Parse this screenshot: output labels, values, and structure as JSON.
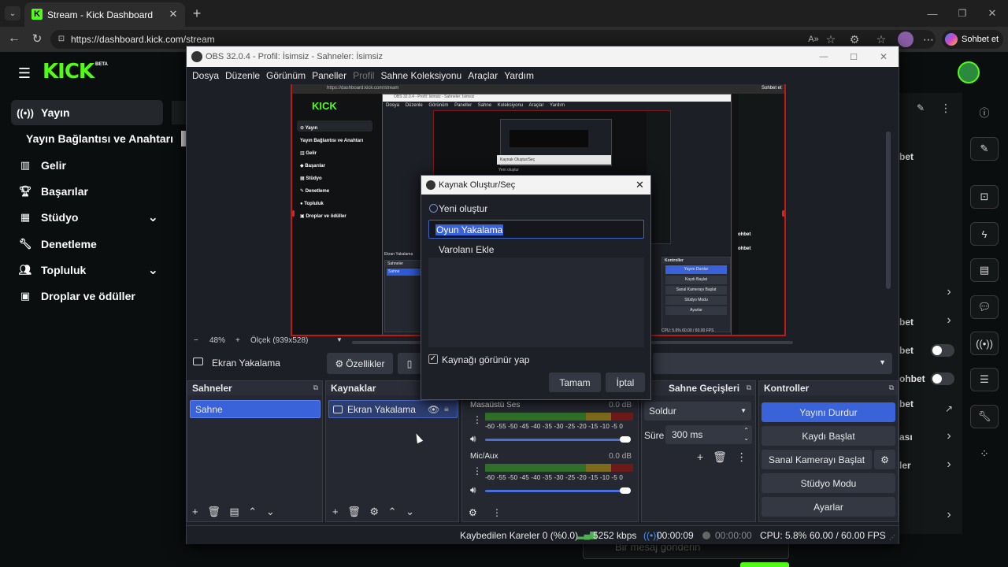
{
  "browser": {
    "tab_title": "Stream - Kick Dashboard",
    "url": "https://dashboard.kick.com/stream",
    "copilot_label": "Sohbet et"
  },
  "kick": {
    "logo": "KICK",
    "logo_badge": "BETA",
    "nav": [
      {
        "label": "Yayın",
        "icon": "broadcast-icon"
      },
      {
        "label": "Yayın Bağlantısı ve Anahtarı",
        "icon": ""
      },
      {
        "label": "Gelir",
        "icon": "revenue-icon"
      },
      {
        "label": "Başarılar",
        "icon": "trophy-icon"
      },
      {
        "label": "Stüdyo",
        "icon": "studio-icon"
      },
      {
        "label": "Denetleme",
        "icon": "wrench-icon"
      },
      {
        "label": "Topluluk",
        "icon": "people-icon"
      },
      {
        "label": "Droplar ve ödüller",
        "icon": "gift-icon"
      }
    ],
    "right_snips": [
      "bet",
      "bet",
      "bet",
      "ohbet",
      "bet",
      "ası",
      "ler"
    ],
    "chat_placeholder": "Bir mesaj gönderin"
  },
  "obs": {
    "title": "OBS 32.0.4 - Profil: İsimsiz - Sahneler: İsimsiz",
    "menu": [
      "Dosya",
      "Düzenle",
      "Görünüm",
      "Paneller",
      "Profil",
      "Sahne Koleksiyonu",
      "Araçlar",
      "Yardım"
    ],
    "zoom": "48%",
    "scale": "Ölçek (939x528)",
    "source_toolbar": {
      "source": "Ekran Yakalama",
      "properties": "Özellikler"
    },
    "docks": {
      "scenes": "Sahneler",
      "sources": "Kaynaklar",
      "transitions": "Sahne Geçişleri",
      "controls": "Kontroller"
    },
    "scenes": [
      "Sahne"
    ],
    "sources": [
      "Ekran Yakalama"
    ],
    "mixer": [
      {
        "name": "Masaüstü Ses",
        "db": "0.0 dB"
      },
      {
        "name": "Mic/Aux",
        "db": "0.0 dB"
      }
    ],
    "meter_ticks": "-60 -55 -50 -45 -40 -35 -30 -25 -20 -15 -10 -5 0",
    "transition": {
      "type": "Soldur",
      "duration_label": "Süre",
      "duration": "300 ms"
    },
    "controls": [
      "Yayını Durdur",
      "Kaydı Başlat",
      "Sanal Kamerayı Başlat",
      "Stüdyo Modu",
      "Ayarlar"
    ],
    "status": {
      "dropped": "Kaybedilen Kareler 0 (%0.0)",
      "bitrate": "5252 kbps",
      "stream_time": "00:00:09",
      "rec_time": "00:00:00",
      "cpu": "CPU: 5.8%",
      "fps": "60.00 / 60.00 FPS"
    }
  },
  "dialog": {
    "title": "Kaynak Oluştur/Seç",
    "create_new": "Yeni oluştur",
    "name_value": "Oyun Yakalama",
    "add_existing": "Varolanı Ekle",
    "make_visible": "Kaynağı görünür yap",
    "ok": "Tamam",
    "cancel": "İptal"
  },
  "nested_preview": {
    "url": "https://dashboard.kick.com/stream",
    "items": [
      "Yayın",
      "Yayın Bağlantısı ve Anahtarı",
      "Gelir",
      "Başarılar",
      "Stüdyo",
      "Denetleme",
      "Topluluk",
      "Droplar ve ödüller"
    ],
    "inner_title": "OBS 32.0.4 - Profil: İsimsiz - Sahneler: İsimsiz",
    "inner_menu": [
      "Dosya",
      "Düzenle",
      "Görünüm",
      "Paneller",
      "Sahne Koleksiyonu",
      "Araçlar",
      "Yardım"
    ],
    "inner_dialog": [
      "Kaynak Oluştur/Seç",
      "Yeni oluştur"
    ],
    "controls": [
      "Kontroller",
      "Yayını Durdur",
      "Kaydı Başlat",
      "Sanal Kamerayı Başlat",
      "Stüdyo Modu",
      "Ayarlar"
    ],
    "scenes": [
      "Sahneler",
      "Sahne"
    ],
    "source": "Ekran Yakalama",
    "chat": [
      "Sohbet et",
      "ohbet",
      "ohbet"
    ],
    "status": "CPU: 5.6%    60.00 / 60.00 FPS"
  }
}
